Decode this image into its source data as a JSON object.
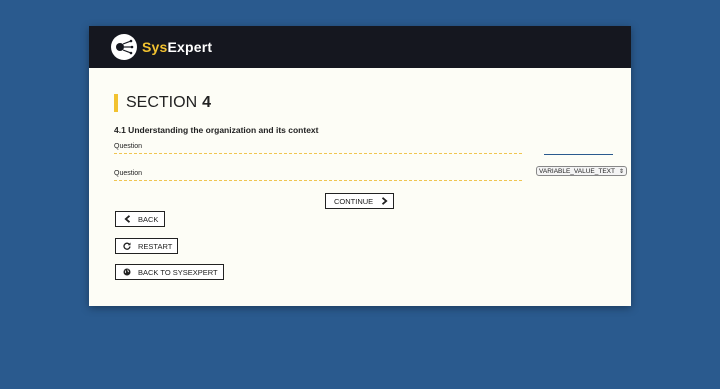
{
  "header": {
    "brand_prefix": "Sys",
    "brand_suffix": "Expert"
  },
  "section": {
    "label": "SECTION",
    "number": "4"
  },
  "subtitle": "4.1 Understanding the organization and its context",
  "questions": [
    {
      "label": "Question"
    },
    {
      "label": "Question",
      "select_value": "VARIABLE_VALUE_TEXT"
    }
  ],
  "buttons": {
    "continue": "CONTINUE",
    "back": "BACK",
    "restart": "RESTART",
    "back_to_sysexpert": "BACK TO SYSEXPERT"
  },
  "icons": {
    "continue": "chevron-right-icon",
    "back": "chevron-left-icon",
    "restart": "refresh-icon",
    "back_to_sysexpert": "globe-icon"
  },
  "colors": {
    "background": "#2a5a8e",
    "header": "#15171f",
    "accent": "#f2c230",
    "card": "#fdfdf6"
  }
}
